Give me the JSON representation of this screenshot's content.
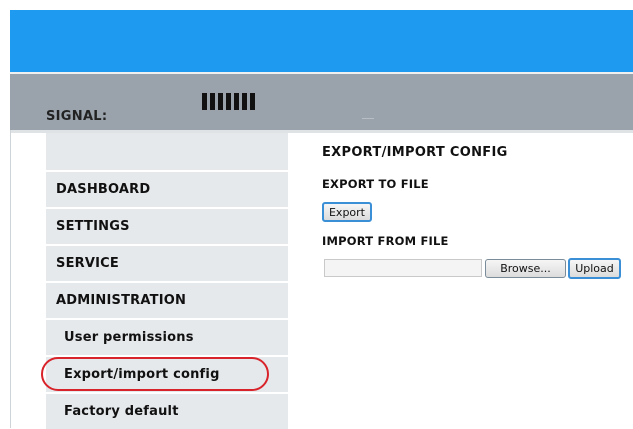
{
  "signal": {
    "label": "SIGNAL:",
    "bars": 7
  },
  "sidebar": {
    "items": [
      {
        "label": "DASHBOARD"
      },
      {
        "label": "SETTINGS"
      },
      {
        "label": "SERVICE"
      },
      {
        "label": "ADMINISTRATION"
      }
    ],
    "subitems": [
      {
        "label": "User permissions"
      },
      {
        "label": "Export/import config"
      },
      {
        "label": "Factory default"
      }
    ]
  },
  "content": {
    "title": "EXPORT/IMPORT CONFIG",
    "export_heading": "EXPORT TO FILE",
    "export_button": "Export",
    "import_heading": "IMPORT FROM FILE",
    "file_value": "",
    "browse_button": "Browse...",
    "upload_button": "Upload"
  },
  "colors": {
    "header": "#1e9bf0",
    "signal_bar": "#9aa3ab",
    "sidebar": "#e6e9ec",
    "highlight": "#d8232a"
  }
}
